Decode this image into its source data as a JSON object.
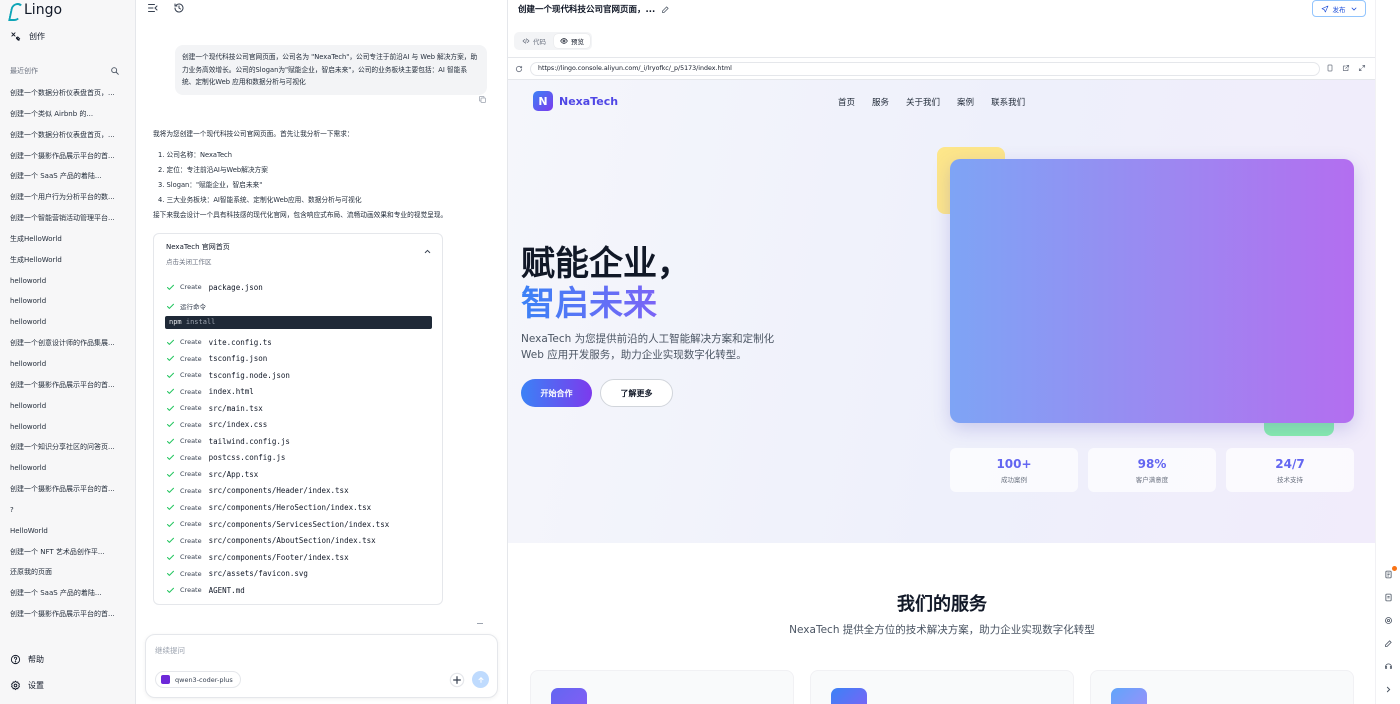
{
  "app": {
    "name": "Lingo"
  },
  "sidebar": {
    "create_label": "创作",
    "recent_label": "最近创作",
    "history": [
      "创建一个数据分析仪表盘首页，...",
      "创建一个类似 Airbnb 的...",
      "创建一个数据分析仪表盘首页，...",
      "创建一个摄影作品展示平台的首...",
      "创建一个 SaaS 产品的着陆...",
      "创建一个用户行为分析平台的数...",
      "创建一个智能营销活动管理平台...",
      "生成HelloWorld",
      "生成HelloWorld",
      "helloworld",
      "helloworld",
      "helloworld",
      "创建一个创意设计师的作品集展...",
      "helloworld",
      "创建一个摄影作品展示平台的首...",
      "helloworld",
      "helloworld",
      "创建一个知识分享社区的问答页...",
      "helloworld",
      "创建一个摄影作品展示平台的首...",
      "?",
      "HelloWorld",
      "创建一个 NFT 艺术品创作平...",
      "还原我的页面",
      "创建一个 SaaS 产品的着陆...",
      "创建一个摄影作品展示平台的首..."
    ],
    "help_label": "帮助",
    "settings_label": "设置"
  },
  "chat": {
    "user_message": "创建一个现代科技公司官网页面，公司名为 \"NexaTech\"，公司专注于前沿AI 与 Web 解决方案，助力业务高效增长。公司的Slogan为\"赋能企业，智启未来\"，公司的业务板块主要包括：AI 智能系统、定制化Web 应用和数据分析与可视化",
    "reply_intro": "我将为您创建一个现代科技公司官网页面。首先让我分析一下需求：",
    "reply_points": [
      "1. 公司名称：NexaTech",
      "2. 定位：专注前沿AI与Web解决方案",
      "3. Slogan：\"赋能企业，智启未来\"",
      "4. 三大业务板块：AI智能系统、定制化Web应用、数据分析与可视化"
    ],
    "reply_after": "接下来我会设计一个具有科技感的现代化官网，包含响应式布局、流畅动画效果和专业的视觉呈现。",
    "card": {
      "title": "NexaTech 官网首页",
      "subtitle": "点击关闭工作区",
      "create_word": "Create",
      "run_label": "运行命令",
      "command_name": "npm",
      "command_arg": "install",
      "files_before": [
        "package.json"
      ],
      "files_after": [
        "vite.config.ts",
        "tsconfig.json",
        "tsconfig.node.json",
        "index.html",
        "src/main.tsx",
        "src/index.css",
        "tailwind.config.js",
        "postcss.config.js",
        "src/App.tsx",
        "src/components/Header/index.tsx",
        "src/components/HeroSection/index.tsx",
        "src/components/ServicesSection/index.tsx",
        "src/components/AboutSection/index.tsx",
        "src/components/Footer/index.tsx",
        "src/assets/favicon.svg",
        "AGENT.md"
      ]
    },
    "composer_placeholder": "继续提问",
    "model_name": "qwen3-coder-plus"
  },
  "preview": {
    "title": "创建一个现代科技公司官网页面，...",
    "publish_label": "发布",
    "tab_code": "代码",
    "tab_preview": "预览",
    "url": "https://lingo.console.aliyun.com/_i/lryofkc/_p/5173/index.html"
  },
  "site": {
    "logo_letter": "N",
    "brand": "NexaTech",
    "nav": [
      "首页",
      "服务",
      "关于我们",
      "案例",
      "联系我们"
    ],
    "hero_line1": "赋能企业，",
    "hero_line2": "智启未来",
    "hero_desc": "NexaTech 为您提供前沿的人工智能解决方案和定制化 Web 应用开发服务，助力企业实现数字化转型。",
    "cta_primary": "开始合作",
    "cta_secondary": "了解更多",
    "stats": [
      {
        "value": "100+",
        "label": "成功案例"
      },
      {
        "value": "98%",
        "label": "客户满意度"
      },
      {
        "value": "24/7",
        "label": "技术支持"
      }
    ],
    "services_title": "我们的服务",
    "services_subtitle": "NexaTech 提供全方位的技术解决方案，助力企业实现数字化转型"
  },
  "colors": {
    "accent": "#4f46e5",
    "gradient_start": "#3b82f6",
    "gradient_end": "#7c3aed",
    "success": "#22c55e"
  }
}
